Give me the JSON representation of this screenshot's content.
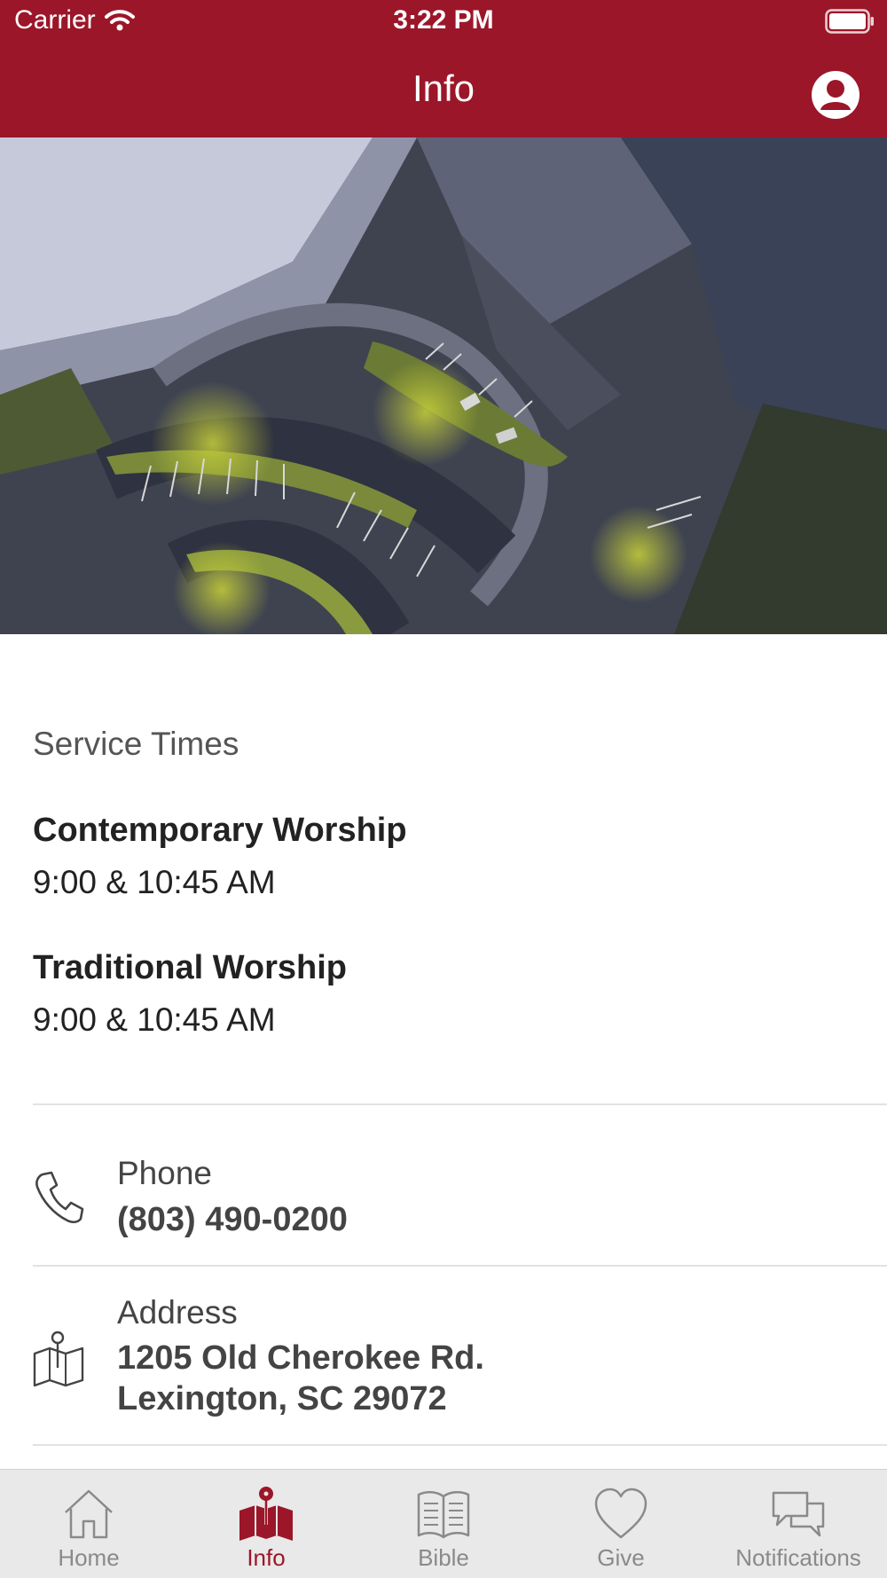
{
  "status_bar": {
    "carrier": "Carrier",
    "time": "3:22 PM"
  },
  "nav": {
    "title": "Info"
  },
  "service_times": {
    "heading": "Service Times",
    "items": [
      {
        "name": "Contemporary Worship",
        "time": "9:00 & 10:45 AM"
      },
      {
        "name": "Traditional Worship",
        "time": "9:00 & 10:45 AM"
      }
    ]
  },
  "contact": {
    "phone": {
      "label": "Phone",
      "value": "(803) 490-0200"
    },
    "address": {
      "label": "Address",
      "line1": "1205 Old Cherokee Rd.",
      "line2": "Lexington, SC 29072"
    }
  },
  "tabs": [
    {
      "label": "Home",
      "icon": "home-icon"
    },
    {
      "label": "Info",
      "icon": "map-pin-icon"
    },
    {
      "label": "Bible",
      "icon": "book-icon"
    },
    {
      "label": "Give",
      "icon": "heart-icon"
    },
    {
      "label": "Notifications",
      "icon": "chat-bubbles-icon"
    }
  ],
  "colors": {
    "brand": "#9b1629",
    "tab_inactive": "#8a8a8a",
    "tabbar_bg": "#e9e9e9"
  }
}
